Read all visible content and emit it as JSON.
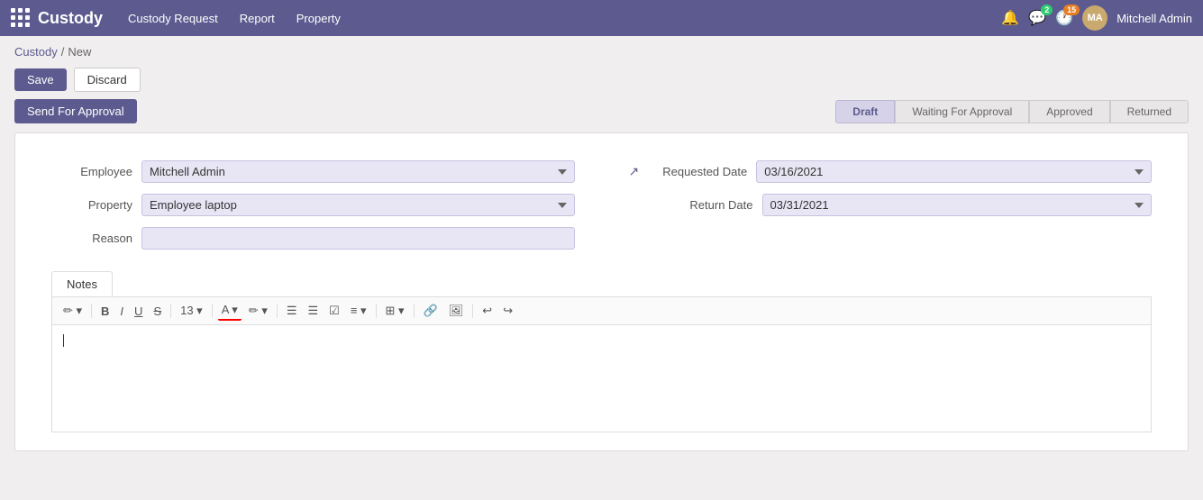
{
  "app": {
    "name": "Custody",
    "logo_icon": "grid-icon"
  },
  "topnav": {
    "menu_items": [
      {
        "label": "Custody Request",
        "id": "custody-request"
      },
      {
        "label": "Report",
        "id": "report"
      },
      {
        "label": "Property",
        "id": "property"
      }
    ],
    "notifications_badge": "",
    "messages_badge": "2",
    "clock_badge": "15",
    "user_name": "Mitchell Admin"
  },
  "breadcrumb": {
    "parent": "Custody",
    "separator": "/",
    "current": "New"
  },
  "toolbar": {
    "save_label": "Save",
    "discard_label": "Discard",
    "send_approval_label": "Send For Approval"
  },
  "status_steps": [
    {
      "label": "Draft",
      "active": true
    },
    {
      "label": "Waiting For Approval",
      "active": false
    },
    {
      "label": "Approved",
      "active": false
    },
    {
      "label": "Returned",
      "active": false
    }
  ],
  "form": {
    "employee_label": "Employee",
    "employee_value": "Mitchell Admin",
    "property_label": "Property",
    "property_value": "Employee laptop",
    "reason_label": "Reason",
    "reason_value": "",
    "requested_date_label": "Requested Date",
    "requested_date_value": "03/16/2021",
    "return_date_label": "Return Date",
    "return_date_value": "03/31/2021"
  },
  "notes": {
    "tab_label": "Notes",
    "toolbar": {
      "pen_label": "✏",
      "bold_label": "B",
      "italic_label": "I",
      "underline_label": "U",
      "strikethrough_label": "✕",
      "font_size_label": "13",
      "font_color_label": "A",
      "highlight_label": "✏",
      "bullet_list_label": "☰",
      "numbered_list_label": "☰",
      "checkbox_label": "☑",
      "align_label": "≡",
      "table_label": "⊞",
      "link_label": "🔗",
      "image_label": "🖼",
      "undo_label": "↩",
      "redo_label": "↪"
    },
    "content": ""
  }
}
